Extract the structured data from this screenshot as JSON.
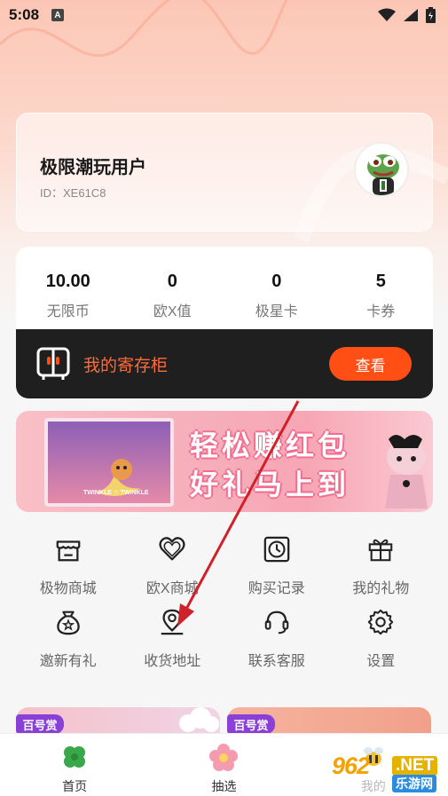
{
  "status_bar": {
    "time": "5:08",
    "notification_glyph": "A",
    "icons": [
      "wifi-icon",
      "signal-icon",
      "battery-icon"
    ]
  },
  "profile": {
    "name": "极限潮玩用户",
    "id_text": "ID：XE61C8",
    "avatar": "frog-avatar"
  },
  "stats": [
    {
      "value": "10.00",
      "label": "无限币"
    },
    {
      "value": "0",
      "label": "欧X值"
    },
    {
      "value": "0",
      "label": "极星卡"
    },
    {
      "value": "5",
      "label": "卡券"
    }
  ],
  "locker": {
    "title": "我的寄存柜",
    "button": "查看"
  },
  "banner": {
    "line1": "轻松赚红包",
    "line2": "好礼马上到",
    "box_label": "TWINKLE ✩ TWINKLE"
  },
  "menu": [
    {
      "label": "极物商城",
      "icon": "store-icon"
    },
    {
      "label": "欧X商城",
      "icon": "heart-icon"
    },
    {
      "label": "购买记录",
      "icon": "clock-icon"
    },
    {
      "label": "我的礼物",
      "icon": "gift-icon"
    },
    {
      "label": "邀新有礼",
      "icon": "money-bag-icon"
    },
    {
      "label": "收货地址",
      "icon": "location-pin-icon"
    },
    {
      "label": "联系客服",
      "icon": "headset-icon"
    },
    {
      "label": "设置",
      "icon": "gear-icon"
    }
  ],
  "promos": [
    {
      "badge": "百号赏"
    },
    {
      "badge": "百号赏"
    }
  ],
  "tabs": [
    {
      "label": "首页",
      "icon": "clover-icon"
    },
    {
      "label": "抽选",
      "icon": "flower-icon"
    },
    {
      "label": "我的",
      "icon": "bee-icon"
    }
  ],
  "watermark": {
    "number": "962",
    "suffix": ".NET",
    "site": "乐游网"
  },
  "colors": {
    "accent": "#ff4f14",
    "locker_text": "#ff6a3a",
    "badge": "#8a3fd6",
    "annotation_arrow": "#d0202a"
  }
}
